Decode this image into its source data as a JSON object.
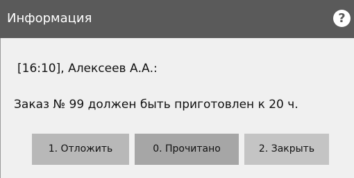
{
  "dialog": {
    "title": "Информация",
    "help_icon": "question-circle-icon",
    "sender_line": "[16:10], Алексеев А.А.:",
    "message": "Заказ № 99 должен быть приготовлен к 20 ч.",
    "buttons": {
      "postpone": "1. Отложить",
      "read": "0. Прочитано",
      "close": "2. Закрыть"
    },
    "colors": {
      "titlebar": "#5a5a5a",
      "body": "#f0f0f0",
      "button_postpone": "#b8b8b8",
      "button_read": "#a6a6a6",
      "button_close": "#c4c4c4"
    }
  }
}
